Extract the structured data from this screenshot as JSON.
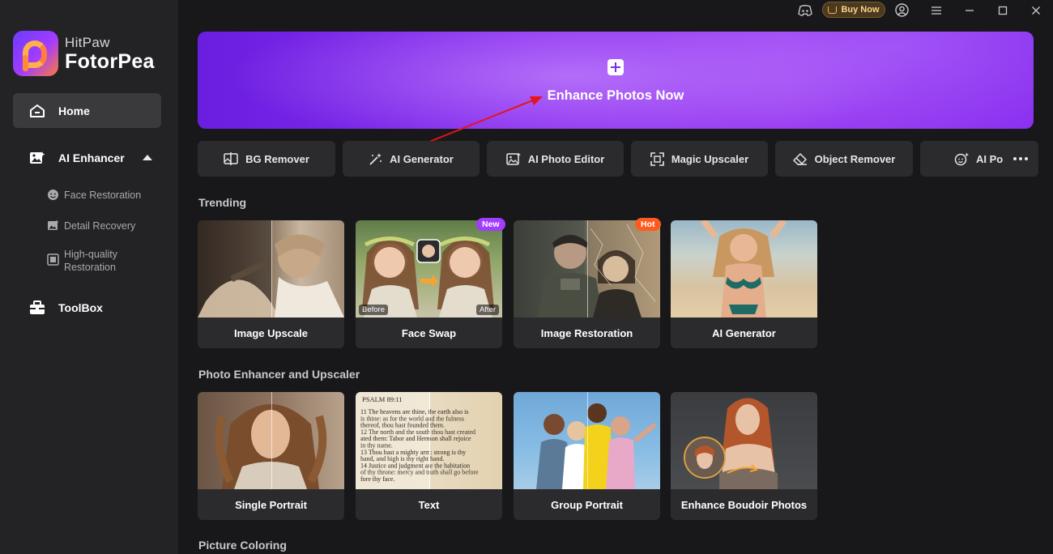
{
  "app": {
    "brand_line1": "HitPaw",
    "brand_line2": "FotorPea"
  },
  "sidebar": {
    "home": "Home",
    "ai_enhancer": "AI Enhancer",
    "sub_items": [
      "Face Restoration",
      "Detail Recovery",
      "High-quality",
      "Restoration"
    ],
    "toolbox": "ToolBox"
  },
  "titlebar": {
    "buy_now": "Buy Now"
  },
  "banner": {
    "title": "Enhance Photos Now"
  },
  "tools": [
    "BG Remover",
    "AI Generator",
    "AI Photo Editor",
    "Magic Upscaler",
    "Object Remover",
    "AI Por"
  ],
  "sections": {
    "trending": "Trending",
    "enhancer": "Photo Enhancer and Upscaler",
    "coloring": "Picture Coloring"
  },
  "trending_cards": [
    "Image Upscale",
    "Face Swap",
    "Image Restoration",
    "AI Generator"
  ],
  "enhancer_cards": [
    "Single Portrait",
    "Text",
    "Group Portrait",
    "Enhance Boudoir Photos"
  ],
  "badges": {
    "new": "New",
    "hot": "Hot"
  },
  "face_swap_tags": {
    "before": "Before",
    "after": "After"
  },
  "text_sample": {
    "header": "PSALM 89:11",
    "lines": [
      "11  The heavens are thine, the earth also is",
      "is  thine: as for the world and the fulness",
      "thereof, thou hast founded them.",
      "12  The north and the south thou hast created",
      "ated them: Tabor and Hermon shall rejoice",
      "in thy name.",
      "13  Thou hast a mighty arm: strong is thy",
      "hand, and high is thy right hand.",
      "14  Justice and judgment are the habitation",
      "of thy throne: mercy and truth shall go before",
      "fore thy face."
    ]
  },
  "colors": {
    "accent_purple": "#8a2ef0",
    "badge_new": "#a23cff",
    "badge_hot": "#ff5a1f",
    "sidebar_bg": "#232325",
    "main_bg": "#18181a"
  }
}
